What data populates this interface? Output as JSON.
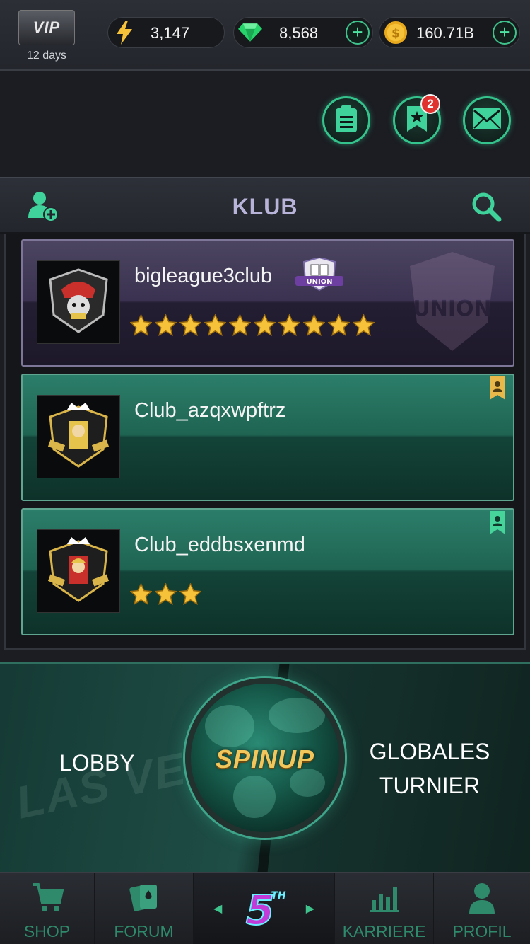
{
  "topbar": {
    "vip_label": "VIP",
    "vip_days": "12 days",
    "energy": "3,147",
    "gems": "8,568",
    "coins": "160.71B"
  },
  "actions": {
    "favorites_badge": "2"
  },
  "klub": {
    "title": "KLUB"
  },
  "clubs": [
    {
      "name": "bigleague3club",
      "stars": 10,
      "union_label": "UNION",
      "watermark": "UNION",
      "style": "purple"
    },
    {
      "name": "Club_azqxwpftrz",
      "stars": 0,
      "style": "teal",
      "bookmark_color": "#e8b84a"
    },
    {
      "name": "Club_eddbsxenmd",
      "stars": 3,
      "style": "teal",
      "bookmark_color": "#46d49a"
    }
  ],
  "banner": {
    "lobby_label": "LOBBY",
    "center_label": "SPINUP",
    "right_label_line1": "GLOBALES",
    "right_label_line2": "TURNIER",
    "bg_text": "LAS VEGAS"
  },
  "nav": {
    "shop": "SHOP",
    "forum": "FORUM",
    "center_logo": "5",
    "center_logo_sup": "TH",
    "karriere": "KARRIERE",
    "profil": "PROFIL"
  },
  "colors": {
    "accent": "#35c38d",
    "nav_text": "#2f8a6b",
    "klub_title": "#b8b3d8",
    "star": "#f6c23a",
    "badge": "#e0322f"
  }
}
